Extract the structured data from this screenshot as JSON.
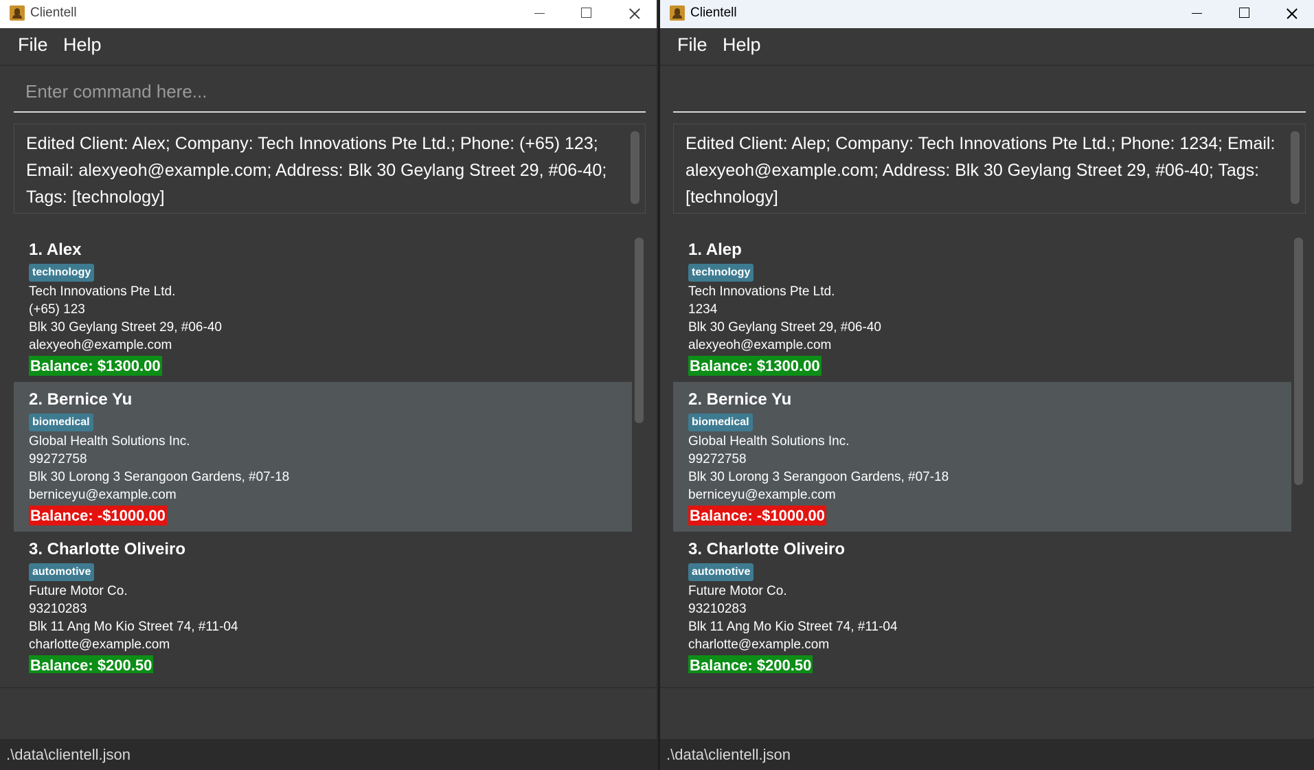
{
  "colors": {
    "accent_tag": "#3e7b91",
    "balance_positive": "#0c8e17",
    "balance_negative": "#e3130f",
    "background": "#393939",
    "selected_card": "#515658"
  },
  "windows": [
    {
      "title": "Clientell",
      "menu": [
        "File",
        "Help"
      ],
      "command": {
        "placeholder": "Enter command here...",
        "value": ""
      },
      "result": "Edited Client: Alex; Company: Tech Innovations Pte Ltd.; Phone: (+65) 123; Email: alexyeoh@example.com; Address: Blk 30 Geylang Street 29, #06-40; Tags: [technology]",
      "clients": [
        {
          "name": "1. Alex",
          "tag": "technology",
          "company": "Tech Innovations Pte Ltd.",
          "phone": "(+65) 123",
          "address": "Blk 30 Geylang Street 29, #06-40",
          "email": "alexyeoh@example.com",
          "balance": "Balance: $1300.00"
        },
        {
          "name": "2. Bernice Yu",
          "tag": "biomedical",
          "company": "Global Health Solutions Inc.",
          "phone": "99272758",
          "address": "Blk 30 Lorong 3 Serangoon Gardens, #07-18",
          "email": "berniceyu@example.com",
          "balance": "Balance: -$1000.00"
        },
        {
          "name": "3. Charlotte Oliveiro",
          "tag": "automotive",
          "company": "Future Motor Co.",
          "phone": "93210283",
          "address": "Blk 11 Ang Mo Kio Street 74, #11-04",
          "email": "charlotte@example.com",
          "balance": "Balance: $200.50"
        }
      ],
      "status": ".\\data\\clientell.json"
    },
    {
      "title": "Clientell",
      "menu": [
        "File",
        "Help"
      ],
      "command": {
        "placeholder": "",
        "value": ""
      },
      "result": "Edited Client: Alep; Company: Tech Innovations Pte Ltd.; Phone: 1234; Email: alexyeoh@example.com; Address: Blk 30 Geylang Street 29, #06-40; Tags: [technology]",
      "clients": [
        {
          "name": "1. Alep",
          "tag": "technology",
          "company": "Tech Innovations Pte Ltd.",
          "phone": "1234",
          "address": "Blk 30 Geylang Street 29, #06-40",
          "email": "alexyeoh@example.com",
          "balance": "Balance: $1300.00"
        },
        {
          "name": "2. Bernice Yu",
          "tag": "biomedical",
          "company": "Global Health Solutions Inc.",
          "phone": "99272758",
          "address": "Blk 30 Lorong 3 Serangoon Gardens, #07-18",
          "email": "berniceyu@example.com",
          "balance": "Balance: -$1000.00"
        },
        {
          "name": "3. Charlotte Oliveiro",
          "tag": "automotive",
          "company": "Future Motor Co.",
          "phone": "93210283",
          "address": "Blk 11 Ang Mo Kio Street 74, #11-04",
          "email": "charlotte@example.com",
          "balance": "Balance: $200.50"
        }
      ],
      "status": ".\\data\\clientell.json"
    }
  ]
}
